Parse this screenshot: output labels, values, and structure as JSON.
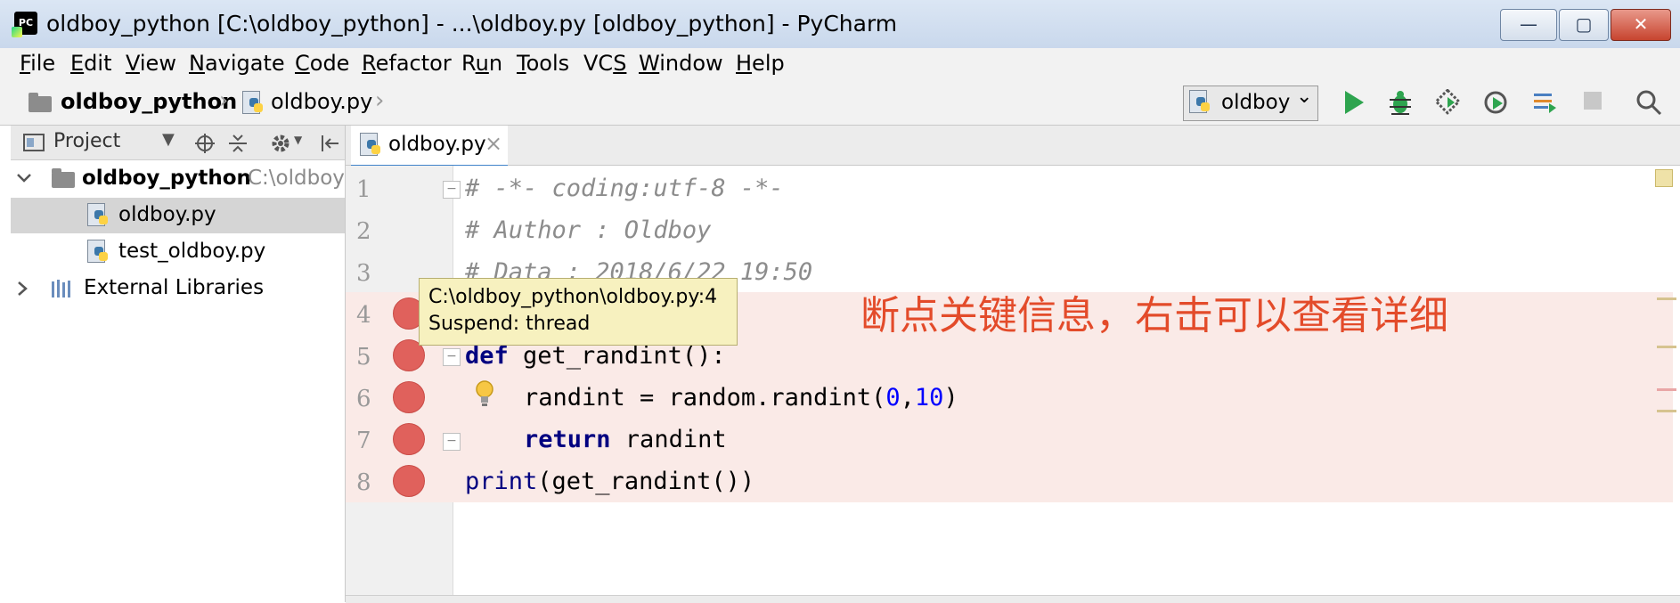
{
  "window": {
    "title": "oldboy_python [C:\\oldboy_python] - ...\\oldboy.py [oldboy_python] - PyCharm",
    "app_icon": "PC",
    "minimize": "—",
    "maximize": "▢",
    "close": "✕"
  },
  "menu": [
    {
      "pre": "",
      "u": "F",
      "post": "ile"
    },
    {
      "pre": "",
      "u": "E",
      "post": "dit"
    },
    {
      "pre": "",
      "u": "V",
      "post": "iew"
    },
    {
      "pre": "",
      "u": "N",
      "post": "avigate"
    },
    {
      "pre": "",
      "u": "C",
      "post": "ode"
    },
    {
      "pre": "",
      "u": "R",
      "post": "efactor"
    },
    {
      "pre": "R",
      "u": "u",
      "post": "n"
    },
    {
      "pre": "",
      "u": "T",
      "post": "ools"
    },
    {
      "pre": "VC",
      "u": "S",
      "post": ""
    },
    {
      "pre": "",
      "u": "W",
      "post": "indow"
    },
    {
      "pre": "",
      "u": "H",
      "post": "elp"
    }
  ],
  "breadcrumb": {
    "project": "oldboy_python",
    "file": "oldboy.py"
  },
  "run_config": {
    "selected": "oldboy",
    "arrow": "⌄"
  },
  "toolbar_icons": [
    "run-icon",
    "debug-icon",
    "coverage-icon",
    "profile-icon",
    "concurrency-icon",
    "stop-icon",
    "search-icon"
  ],
  "project_panel": {
    "title": "Project",
    "root": {
      "name": "oldboy_python",
      "path": "C:\\oldboy"
    },
    "files": [
      "oldboy.py",
      "test_oldboy.py"
    ],
    "external": "External Libraries"
  },
  "editor": {
    "tab": "oldboy.py",
    "tab_close": "×",
    "line_numbers": [
      "1",
      "2",
      "3",
      "4",
      "5",
      "6",
      "7",
      "8"
    ],
    "lines": {
      "l1": "# -*- coding:utf-8 -*-",
      "l2": "# Author : Oldboy",
      "l3": "# Data : 2018/6/22 19:50",
      "l5_kw": "def",
      "l5_rest": " get_randint():",
      "l6_a": "randint = random.randint(",
      "l6_n1": "0",
      "l6_c": ",",
      "l6_n2": "10",
      "l6_b": ")",
      "l7_kw": "return",
      "l7_rest": " randint",
      "l8_fn": "print",
      "l8_rest": "(get_randint())"
    }
  },
  "tooltip": {
    "line1": "C:\\oldboy_python\\oldboy.py:4",
    "line2": "Suspend: thread"
  },
  "annotation": "断点关键信息，右击可以查看详细",
  "colors": {
    "breakpoint": "#e0615c",
    "breakpoint_band": "#faeae7",
    "annotation": "#e34b2a",
    "tooltip_bg": "#f7f1bf",
    "run_green": "#2ea44f"
  }
}
